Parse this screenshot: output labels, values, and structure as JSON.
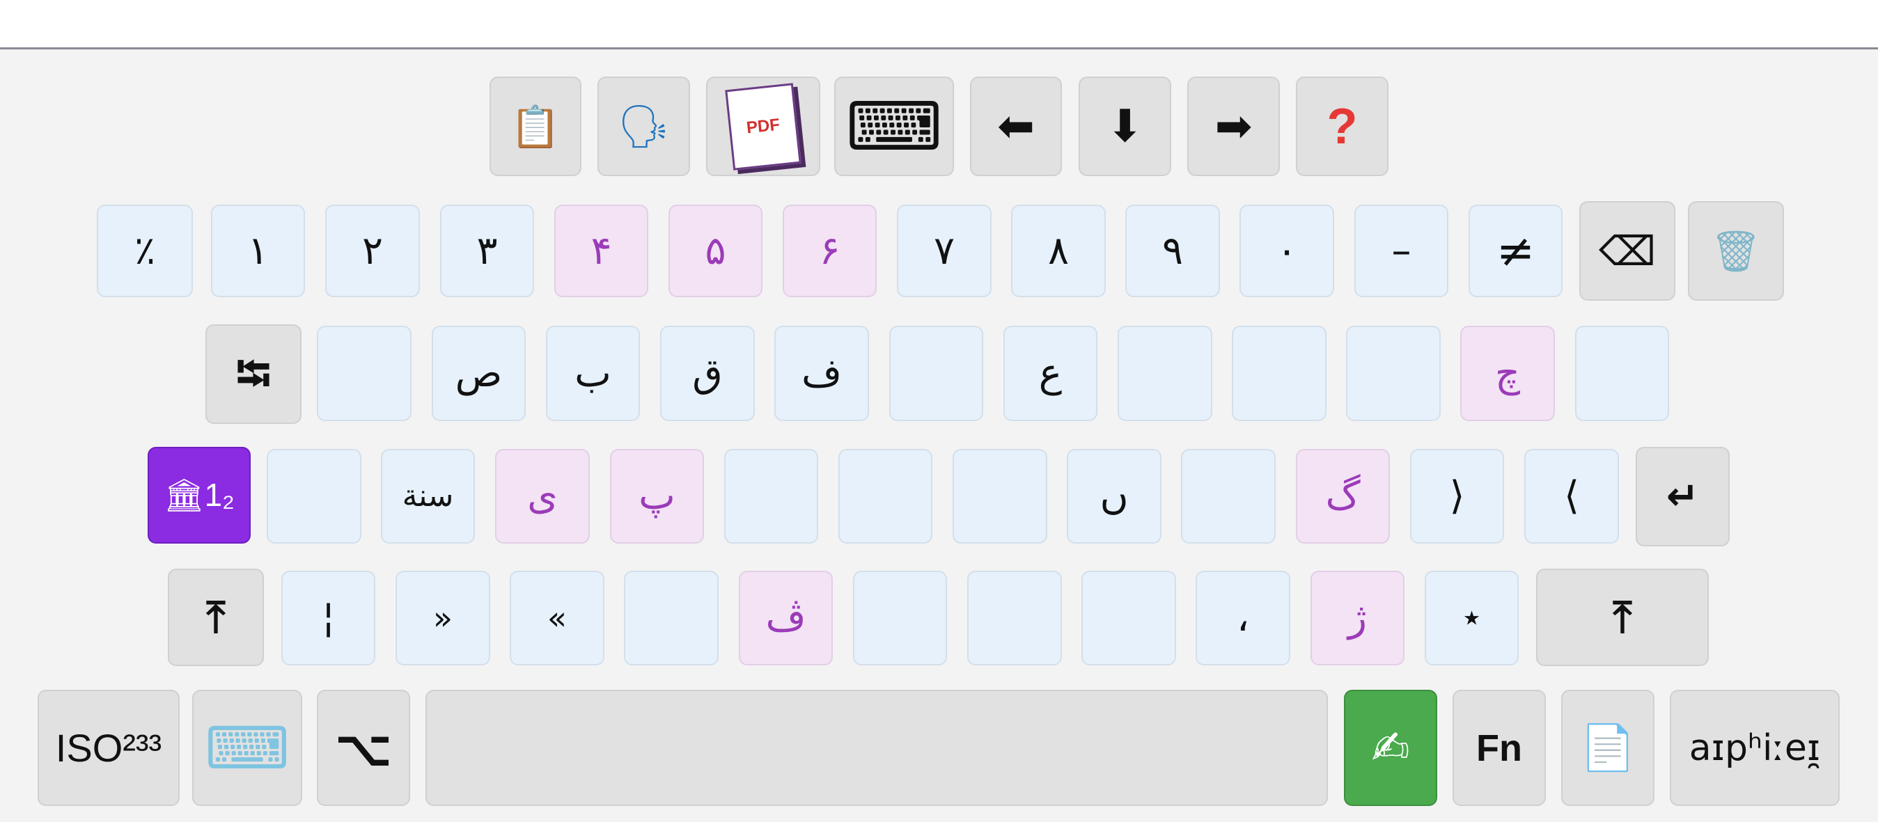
{
  "toolbar": {
    "clipboard_icon": "📋",
    "speak_icon": "🗣",
    "pdf_icon": "PDF",
    "keyboard_icon": "⌨",
    "left_arrow": "⬅",
    "down_arrow": "⬇",
    "right_arrow": "➡",
    "help": "?"
  },
  "row1": [
    "٪",
    "١",
    "٢",
    "٣",
    "۴",
    "۵",
    "۶",
    "٧",
    "٨",
    "٩",
    "٠",
    "–",
    "≠"
  ],
  "row1_controls": {
    "backspace": "⌫",
    "trash": "🗑"
  },
  "row2": {
    "tab": "⭾",
    "keys": [
      "",
      "ص",
      "ب",
      "ق",
      "ف",
      "",
      "ع",
      "",
      "",
      "",
      "چ",
      ""
    ]
  },
  "row3": {
    "mode": "🏛1₂",
    "keys": [
      "",
      "سنة",
      "ی",
      "پ",
      "",
      "",
      "",
      "ں",
      "",
      "گ",
      "⟩",
      "⟨"
    ],
    "enter": "↵"
  },
  "row4": {
    "shift_left": "⤒",
    "keys": [
      "¦",
      "»",
      "«",
      "",
      "ڤ",
      "",
      "",
      "",
      "،",
      "ژ",
      "⋆"
    ],
    "shift_right": "⤒"
  },
  "row5": {
    "iso_label": "ISO²³³",
    "keyboard_icon": "⌨",
    "alt_icon": "⌥",
    "space": "",
    "handwrite_icon": "✍",
    "fn_label": "Fn",
    "doc_icon": "📄",
    "ipa_label": "aɪpʰiːeɪ̯"
  },
  "colors": {
    "blue_key": "#e6f1fb",
    "pink_key": "#f3e3f5",
    "gray_key": "#e1e1e1",
    "mode_key": "#8b2be2",
    "handwrite_key": "#4aaa4d",
    "help_red": "#e53935"
  }
}
